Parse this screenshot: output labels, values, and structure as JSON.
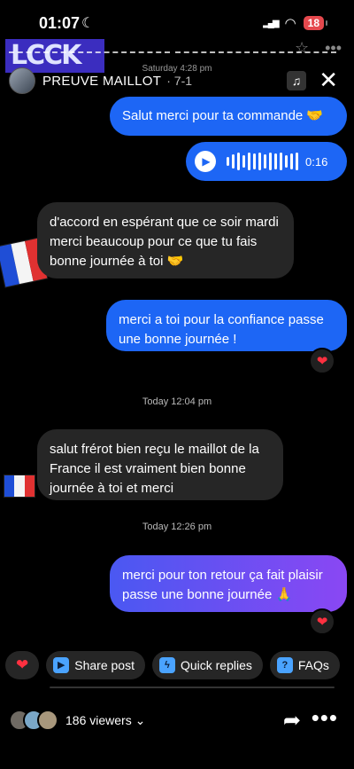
{
  "status": {
    "time": "01:07",
    "battery": "18"
  },
  "story": {
    "title": "PREUVE MAILLOT",
    "subtitle": "· 7-1",
    "date_faded": "Saturday 4:28 pm"
  },
  "messages": [
    {
      "id": "m1",
      "text": "Salut merci pour ta commande 🤝"
    },
    {
      "id": "m2",
      "voice_duration": "0:16"
    },
    {
      "id": "m3",
      "text": "d'accord en espérant que ce soir mardi merci beaucoup pour ce que tu fais bonne journée à toi 🤝"
    },
    {
      "id": "m4",
      "text": "merci a toi pour la confiance passe une bonne journée !",
      "reaction": "❤"
    },
    {
      "id": "m5",
      "timestamp": "Today 12:04 pm"
    },
    {
      "id": "m6",
      "text": "salut frérot bien reçu le maillot de la France il est vraiment bien bonne journée à toi et merci"
    },
    {
      "id": "m7",
      "timestamp": "Today 12:26 pm"
    },
    {
      "id": "m8",
      "text": "merci pour ton retour ça fait plaisir passe une bonne journée 🙏",
      "reaction": "❤"
    }
  ],
  "quick_actions": {
    "heart": "❤",
    "share_post": "Share post",
    "quick_replies": "Quick replies",
    "faqs": "FAQs"
  },
  "footer": {
    "viewers": "186 viewers ⌄"
  },
  "colors": {
    "sent": "#1d66f5",
    "received": "#262626",
    "heart": "#ff3040"
  }
}
